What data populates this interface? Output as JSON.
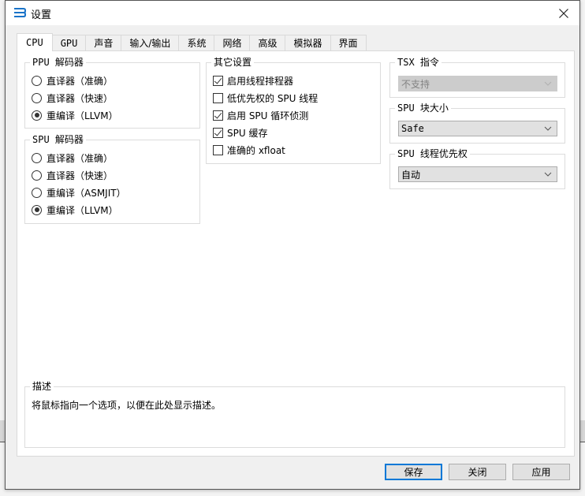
{
  "window": {
    "title": "设置",
    "close_icon": "close-icon",
    "app_icon": "rpcs3-logo-icon"
  },
  "tabs": [
    {
      "label": "CPU",
      "active": true
    },
    {
      "label": "GPU",
      "active": false
    },
    {
      "label": "声音",
      "active": false
    },
    {
      "label": "输入/输出",
      "active": false
    },
    {
      "label": "系统",
      "active": false
    },
    {
      "label": "网络",
      "active": false
    },
    {
      "label": "高级",
      "active": false
    },
    {
      "label": "模拟器",
      "active": false
    },
    {
      "label": "界面",
      "active": false
    }
  ],
  "ppu_decoder": {
    "title": "PPU 解码器",
    "options": [
      {
        "label": "直译器（准确）",
        "selected": false
      },
      {
        "label": "直译器（快速）",
        "selected": false
      },
      {
        "label": "重编译（LLVM）",
        "selected": true
      }
    ]
  },
  "spu_decoder": {
    "title": "SPU 解码器",
    "options": [
      {
        "label": "直译器（准确）",
        "selected": false
      },
      {
        "label": "直译器（快速）",
        "selected": false
      },
      {
        "label": "重编译（ASMJIT）",
        "selected": false
      },
      {
        "label": "重编译（LLVM）",
        "selected": true
      }
    ]
  },
  "other_settings": {
    "title": "其它设置",
    "options": [
      {
        "label": "启用线程排程器",
        "checked": true
      },
      {
        "label": "低优先权的 SPU 线程",
        "checked": false
      },
      {
        "label": "启用 SPU 循环侦测",
        "checked": true
      },
      {
        "label": "SPU 缓存",
        "checked": true
      },
      {
        "label": "准确的 xfloat",
        "checked": false
      }
    ]
  },
  "tsx": {
    "title": "TSX 指令",
    "value": "不支持",
    "disabled": true
  },
  "spu_block_size": {
    "title": "SPU 块大小",
    "value": "Safe"
  },
  "spu_thread_priority": {
    "title": "SPU 线程优先权",
    "value": "自动"
  },
  "description": {
    "title": "描述",
    "text": "将鼠标指向一个选项，以便在此处显示描述。"
  },
  "buttons": {
    "save": "保存",
    "close": "关闭",
    "apply": "应用"
  },
  "colors": {
    "accent": "#0078d7",
    "disabled_combo": "#cccccc"
  }
}
